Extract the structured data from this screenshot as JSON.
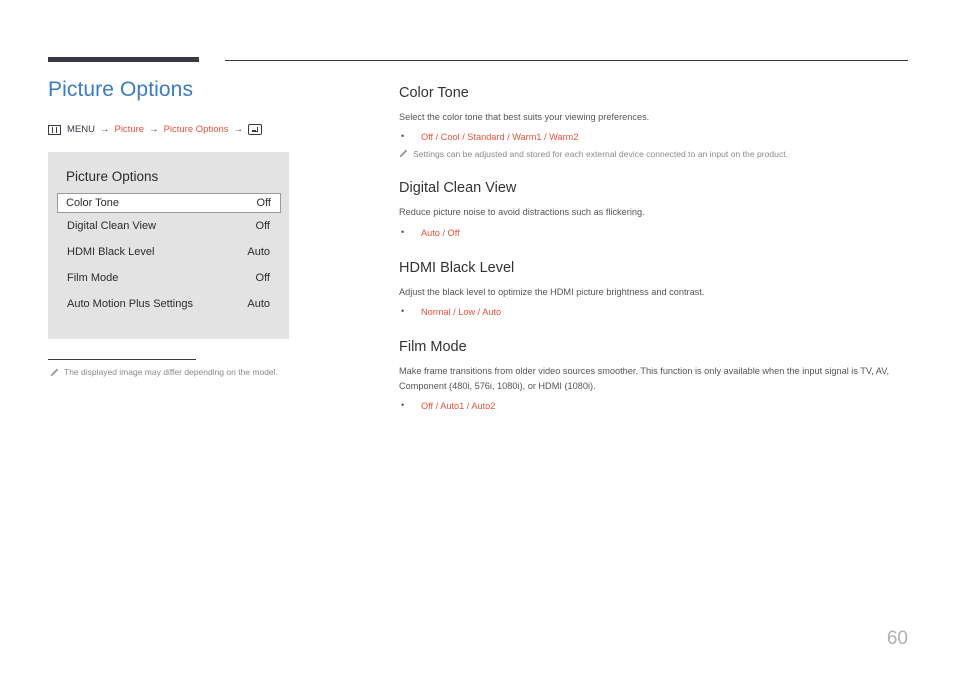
{
  "page": {
    "title": "Picture Options",
    "number": "60"
  },
  "breadcrumb": {
    "menu_icon": "menu-icon",
    "menu_label": "MENU",
    "arrow": "→",
    "items": [
      {
        "label": "Picture"
      },
      {
        "label": "Picture Options"
      }
    ],
    "enter_icon": "enter-key-icon"
  },
  "osd": {
    "title": "Picture Options",
    "rows": [
      {
        "label": "Color Tone",
        "value": "Off",
        "selected": true
      },
      {
        "label": "Digital Clean View",
        "value": "Off",
        "selected": false
      },
      {
        "label": "HDMI Black Level",
        "value": "Auto",
        "selected": false
      },
      {
        "label": "Film Mode",
        "value": "Off",
        "selected": false
      },
      {
        "label": "Auto Motion Plus Settings",
        "value": "Auto",
        "selected": false
      }
    ]
  },
  "footnote": {
    "icon": "pencil-icon",
    "text": "The displayed image may differ depending on the model."
  },
  "sections": [
    {
      "title": "Color Tone",
      "description": "Select the color tone that best suits your viewing preferences.",
      "options": "Off / Cool / Standard / Warm1 / Warm2",
      "note": "Settings can be adjusted and stored for each external device connected to an input on the product."
    },
    {
      "title": "Digital Clean View",
      "description": "Reduce picture noise to avoid distractions such as flickering.",
      "options": "Auto / Off",
      "note": ""
    },
    {
      "title": "HDMI Black Level",
      "description": "Adjust the black level to optimize the HDMI picture brightness and contrast.",
      "options": "Normal / Low / Auto",
      "note": ""
    },
    {
      "title": "Film Mode",
      "description": "Make frame transitions from older video sources smoother. This function is only available when the input signal is TV, AV, Component (480i, 576i, 1080i), or HDMI (1080i).",
      "options": "Off / Auto1 / Auto2",
      "note": ""
    }
  ],
  "colors": {
    "accent_orange": "#e8533a",
    "title_blue": "#3a7cbf",
    "rule_dark": "#3b3744",
    "panel_gray": "#e3e3e3",
    "page_number_gray": "#b0b0b0"
  }
}
